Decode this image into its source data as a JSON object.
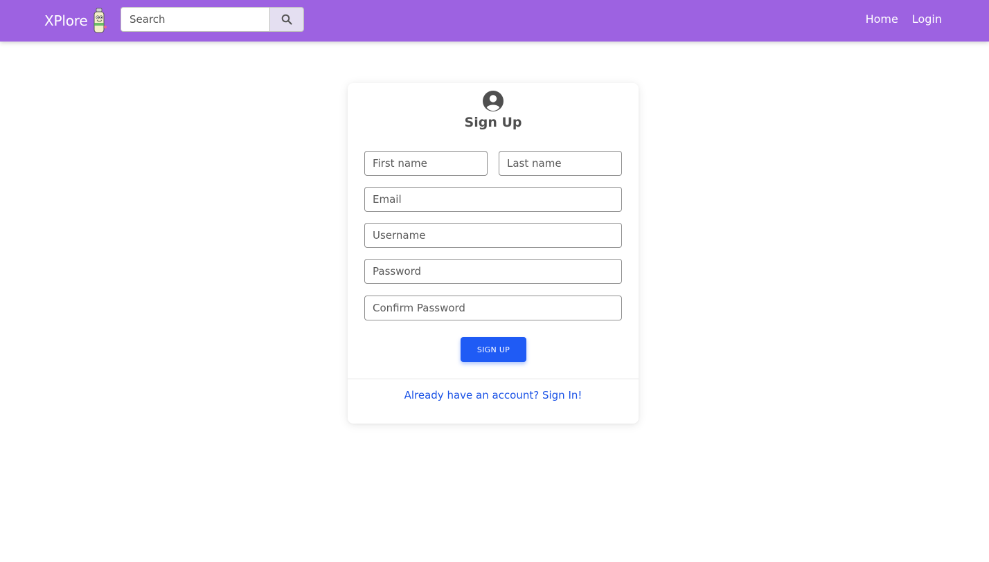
{
  "nav": {
    "brand": "XPlore",
    "search_placeholder": "Search",
    "links": [
      "Home",
      "Login"
    ]
  },
  "form": {
    "title": "Sign Up",
    "fields": {
      "first_name": "First name",
      "last_name": "Last name",
      "email": "Email",
      "username": "Username",
      "password": "Password",
      "confirm_password": "Confirm Password"
    },
    "submit_label": "SIGN UP",
    "signin_link": "Already have an account? Sign In!"
  },
  "colors": {
    "navbar": "#9d62e1",
    "primary_button": "#1f5bf5",
    "link": "#1a52e6"
  },
  "icons": {
    "search": "search-icon",
    "user": "user-circle-icon",
    "logo": "spray-can-mascot-logo"
  }
}
